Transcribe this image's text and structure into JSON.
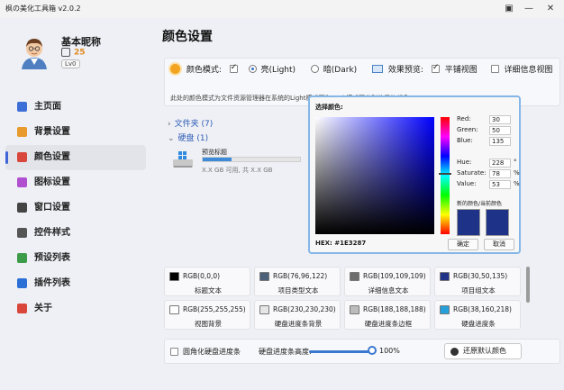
{
  "window": {
    "title": "枫の美化工具箱 v2.0.2"
  },
  "user": {
    "name": "基本昵称",
    "coins": "25",
    "level": "Lv0"
  },
  "nav": [
    {
      "label": "主页面",
      "icon": "home-icon",
      "color": "#3d6ed8"
    },
    {
      "label": "背景设置",
      "icon": "image-icon",
      "color": "#e99a2c"
    },
    {
      "label": "颜色设置",
      "icon": "palette-icon",
      "color": "#d9463b",
      "active": true
    },
    {
      "label": "图标设置",
      "icon": "flower-icon",
      "color": "#b04fd0"
    },
    {
      "label": "窗口设置",
      "icon": "window-icon",
      "color": "#444444"
    },
    {
      "label": "控件样式",
      "icon": "controls-icon",
      "color": "#555555"
    },
    {
      "label": "预设列表",
      "icon": "list-icon",
      "color": "#3c9c4a"
    },
    {
      "label": "插件列表",
      "icon": "plugin-icon",
      "color": "#2a6fd6"
    },
    {
      "label": "关于",
      "icon": "about-icon",
      "color": "#d9463b"
    }
  ],
  "page": {
    "title": "颜色设置",
    "color_mode_label": "颜色模式:",
    "light_label": "亮(Light)",
    "dark_label": "暗(Dark)",
    "preview_label": "效果预览:",
    "tile_label": "平铺视图",
    "detail_label": "详细信息视图",
    "description": "此处的颜色模式为文件资源管理器在系统的Light模式下和Dark模式下分别使用的颜色"
  },
  "explorer": {
    "folders_label": "文件夹 (7)",
    "disks_label": "硬盘 (1)",
    "disk_name": "预览标题",
    "disk_size": "X.X GB 可用, 共 X.X GB",
    "disk_fill": 0.3
  },
  "picker": {
    "title": "选择颜色:",
    "fields": [
      {
        "label": "Red:",
        "value": "30",
        "unit": ""
      },
      {
        "label": "Green:",
        "value": "50",
        "unit": ""
      },
      {
        "label": "Blue:",
        "value": "135",
        "unit": ""
      },
      {
        "label": "Hue:",
        "value": "228",
        "unit": "°"
      },
      {
        "label": "Saturate:",
        "value": "78",
        "unit": "%"
      },
      {
        "label": "Value:",
        "value": "53",
        "unit": "%"
      }
    ],
    "swatch_label": "新的颜色/当前颜色",
    "new_color": "#1E3287",
    "current_color": "#1E3287",
    "hex_text": "HEX: #1E3287",
    "ok_label": "确定",
    "cancel_label": "取消"
  },
  "colors": [
    {
      "rgb": "RGB(0,0,0)",
      "label": "标题文本",
      "color": "#000000"
    },
    {
      "rgb": "RGB(76,96,122)",
      "label": "项目类型文本",
      "color": "#4c607a"
    },
    {
      "rgb": "RGB(109,109,109)",
      "label": "详细信息文本",
      "color": "#6d6d6d"
    },
    {
      "rgb": "RGB(30,50,135)",
      "label": "项目组文本",
      "color": "#1e3287"
    },
    {
      "rgb": "RGB(255,255,255)",
      "label": "视图背景",
      "color": "#ffffff"
    },
    {
      "rgb": "RGB(230,230,230)",
      "label": "硬盘进度条背景",
      "color": "#e6e6e6"
    },
    {
      "rgb": "RGB(188,188,188)",
      "label": "硬盘进度条边框",
      "color": "#bcbcbc"
    },
    {
      "rgb": "RGB(38,160,218)",
      "label": "硬盘进度条",
      "color": "#26a0da"
    }
  ],
  "bottom": {
    "rounded_label": "圆角化硬盘进度条",
    "height_label": "硬盘进度条高度:",
    "height_value": "100%",
    "reset_label": "还原默认颜色"
  }
}
